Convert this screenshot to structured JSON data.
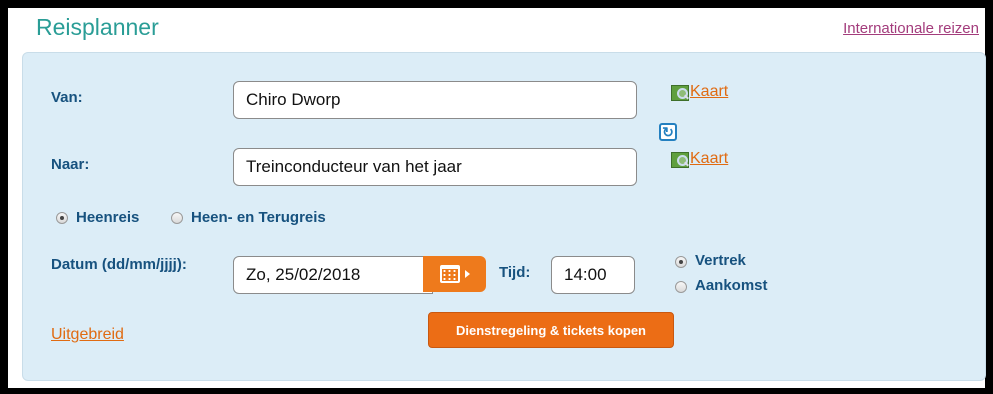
{
  "header": {
    "title": "Reisplanner",
    "international_link": "Internationale reizen"
  },
  "form": {
    "from": {
      "label": "Van:",
      "value": "Chiro Dworp",
      "map_link": "Kaart"
    },
    "to": {
      "label": "Naar:",
      "value": "Treinconducteur van het jaar",
      "map_link": "Kaart"
    },
    "trip_type": {
      "options": [
        "Heenreis",
        "Heen- en Terugreis"
      ],
      "selected": "Heenreis"
    },
    "date": {
      "label": "Datum (dd/mm/jjjj):",
      "value": "Zo, 25/02/2018"
    },
    "time": {
      "label": "Tijd:",
      "value": "14:00"
    },
    "time_mode": {
      "options": [
        "Vertrek",
        "Aankomst"
      ],
      "selected": "Vertrek"
    },
    "advanced_link": "Uitgebreid",
    "submit_label": "Dienstregeling & tickets kopen"
  },
  "colors": {
    "accent_orange": "#ec6d15",
    "title_teal": "#2a9d96",
    "label_blue": "#17527f",
    "panel_bg": "#dcedf7"
  },
  "icons": [
    "map-icon",
    "swap-icon",
    "calendar-icon"
  ]
}
